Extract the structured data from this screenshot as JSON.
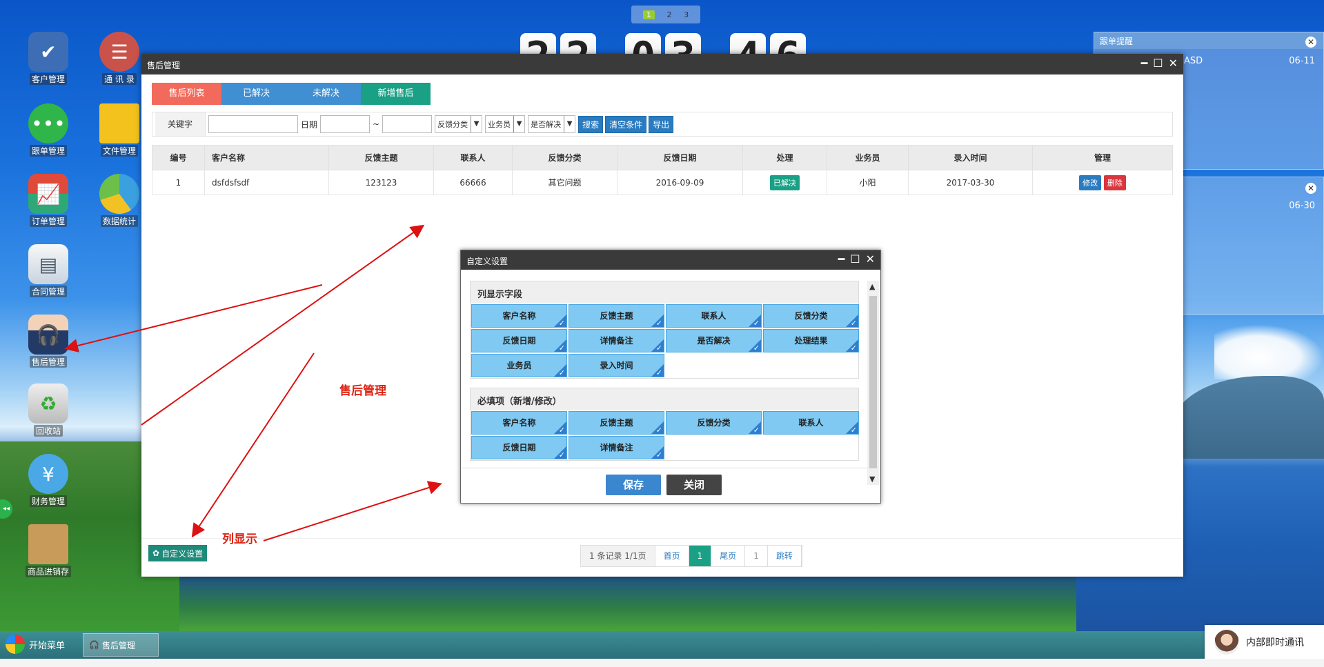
{
  "desktop": {
    "icons": [
      {
        "label": "客户管理",
        "icon": "customer-check-icon"
      },
      {
        "label": "通 讯 录",
        "icon": "address-book-icon"
      },
      {
        "label": "跟单管理",
        "icon": "chat-bubble-icon"
      },
      {
        "label": "文件管理",
        "icon": "folder-icon"
      },
      {
        "label": "订单管理",
        "icon": "line-chart-icon"
      },
      {
        "label": "数据统计",
        "icon": "pie-chart-icon"
      },
      {
        "label": "合同管理",
        "icon": "contract-document-icon"
      },
      {
        "label": "售后管理",
        "icon": "support-agent-icon"
      },
      {
        "label": "回收站",
        "icon": "recycle-bin-icon"
      },
      {
        "label": "财务管理",
        "icon": "yen-coin-icon"
      },
      {
        "label": "商品进销存",
        "icon": "cardboard-box-icon"
      }
    ],
    "workspace_tabs": [
      "1",
      "2",
      "3"
    ],
    "clock": {
      "h1": "2",
      "h2": "2",
      "m1": "0",
      "m2": "3",
      "s1": "4",
      "s2": "6"
    },
    "reminder": {
      "title": "跟单提醒",
      "item1_text": "ASD",
      "item1_date": "06-11",
      "item2_date": "06-30"
    },
    "side_toggle": "◂◂"
  },
  "main_window": {
    "title": "售后管理",
    "tabs": [
      {
        "label": "售后列表",
        "color": "#f26a5c"
      },
      {
        "label": "已解决",
        "color": "#3f8fd2"
      },
      {
        "label": "未解决",
        "color": "#3f8fd2"
      },
      {
        "label": "新增售后",
        "color": "#1aa085"
      }
    ],
    "filter": {
      "keyword_label": "关键字",
      "date_label": "日期",
      "date_sep": "~",
      "select_feedback": "反馈分类",
      "select_salesman": "业务员",
      "select_solved": "是否解决",
      "search_button": "搜索",
      "clear_button": "清空条件",
      "export_button": "导出"
    },
    "table": {
      "headers": [
        "编号",
        "客户名称",
        "反馈主题",
        "联系人",
        "反馈分类",
        "反馈日期",
        "处理",
        "业务员",
        "录入时间",
        "管理"
      ],
      "rows": [
        {
          "id": "1",
          "customer": "dsfdsfsdf",
          "subject": "123123",
          "contact": "66666",
          "category": "其它问题",
          "date": "2016-09-09",
          "status": "已解决",
          "salesman": "小阳",
          "created": "2017-03-30",
          "edit": "修改",
          "delete": "删除"
        }
      ]
    },
    "custom_settings_button": "自定义设置",
    "pager": {
      "info": "1 条记录 1/1页",
      "first": "首页",
      "current": "1",
      "last": "尾页",
      "page_input": "1",
      "jump": "跳转"
    }
  },
  "dialog": {
    "title": "自定义设置",
    "section1_title": "列显示字段",
    "section1_fields": [
      "客户名称",
      "反馈主题",
      "联系人",
      "反馈分类",
      "反馈日期",
      "详情备注",
      "是否解决",
      "处理结果",
      "业务员",
      "录入时间"
    ],
    "section2_title": "必填项（新增/修改）",
    "section2_fields": [
      "客户名称",
      "反馈主题",
      "反馈分类",
      "联系人",
      "反馈日期",
      "详情备注"
    ],
    "save_button": "保存",
    "close_button": "关闭"
  },
  "annotations": {
    "label1": "售后管理",
    "label2": "列显示"
  },
  "taskbar": {
    "start_label": "开始菜单",
    "active_item": "售后管理",
    "im_label": "内部即时通讯"
  },
  "colors": {
    "accent_blue": "#2a7bc0",
    "success_green": "#1aa085",
    "danger_red": "#d9363e",
    "annotation_red": "#dd1111"
  }
}
